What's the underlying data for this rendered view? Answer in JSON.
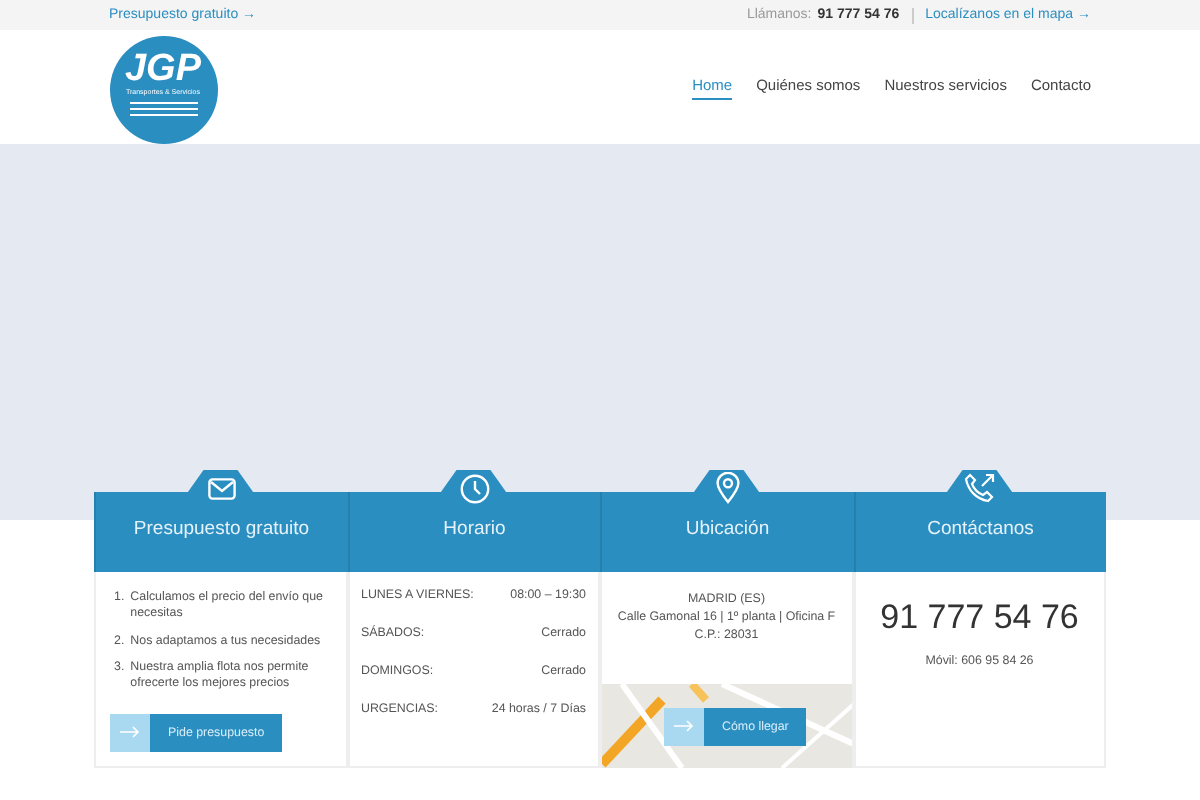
{
  "topbar": {
    "quote_link": "Presupuesto gratuito →",
    "call_label": "Llámanos:",
    "phone": "91 777 54 76",
    "map_link": "Localízanos en el mapa →"
  },
  "logo": {
    "letters": "JGP",
    "tagline": "Transportes & Servicios"
  },
  "nav": [
    {
      "label": "Home",
      "selected": true
    },
    {
      "label": "Quiénes somos",
      "selected": false
    },
    {
      "label": "Nuestros servicios",
      "selected": false
    },
    {
      "label": "Contacto",
      "selected": false
    }
  ],
  "cards": [
    {
      "kind": "list",
      "title": "Presupuesto gratuito",
      "items": [
        {
          "number": "1.",
          "text": "Calculamos el precio del envío que necesitas"
        },
        {
          "number": "2.",
          "text": "Nos adaptamos a tus necesidades"
        },
        {
          "number": "3.",
          "text": "Nuestra amplia flota nos permite ofrecerte los mejores precios"
        }
      ],
      "button": "Pide presupuesto"
    },
    {
      "kind": "schedule",
      "title": "Horario",
      "rows": [
        {
          "day": "LUNES A VIERNES:",
          "hours": "08:00 – 19:30"
        },
        {
          "day": "SÁBADOS:",
          "hours": "Cerrado"
        },
        {
          "day": "DOMINGOS:",
          "hours": "Cerrado"
        },
        {
          "day": "URGENCIAS:",
          "hours": "24 horas / 7 Días"
        }
      ]
    },
    {
      "kind": "location",
      "title": "Ubicación",
      "lines": [
        "MADRID (ES)",
        "Calle Gamonal 16 | 1º planta | Oficina F",
        "C.P.: 28031"
      ],
      "button": "Cómo llegar"
    },
    {
      "kind": "contact",
      "title": "Contáctanos",
      "phone": "91 777 54 76",
      "mobile": "Móvil: 606 95 84 26"
    }
  ]
}
